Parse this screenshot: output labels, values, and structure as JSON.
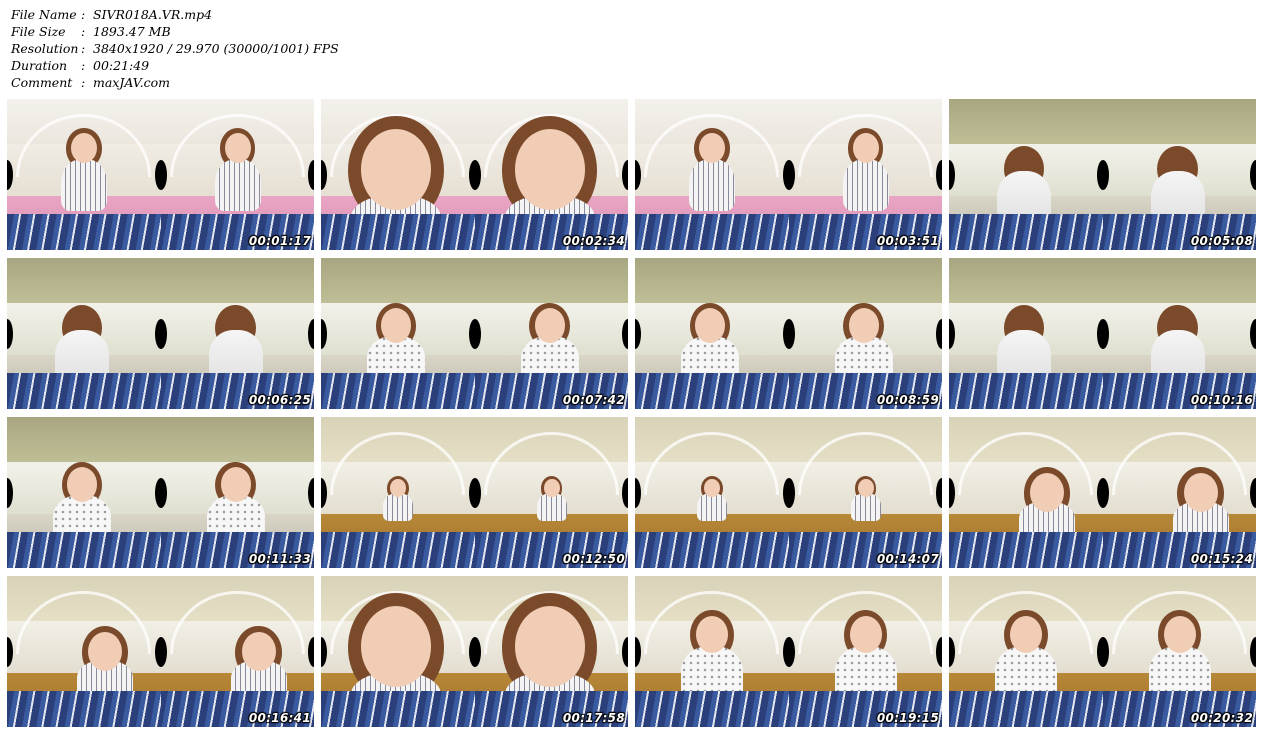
{
  "header": {
    "rows": [
      {
        "key": "File Name",
        "sep": ":",
        "value": "SIVR018A.VR.mp4"
      },
      {
        "key": "File Size",
        "sep": ":",
        "value": "1893.47 MB"
      },
      {
        "key": "Resolution",
        "sep": ":",
        "value": "3840x1920 / 29.970 (30000/1001) FPS"
      },
      {
        "key": "Duration",
        "sep": ":",
        "value": "00:21:49"
      },
      {
        "key": "Comment",
        "sep": ":",
        "value": "maxJAV.com"
      }
    ]
  },
  "thumbnails": [
    {
      "time": "00:01:17",
      "scene": "bedroom"
    },
    {
      "time": "00:02:34",
      "scene": "bedroom-closeup"
    },
    {
      "time": "00:03:51",
      "scene": "bedroom"
    },
    {
      "time": "00:05:08",
      "scene": "kitchen-back"
    },
    {
      "time": "00:06:25",
      "scene": "kitchen-back"
    },
    {
      "time": "00:07:42",
      "scene": "kitchen-front"
    },
    {
      "time": "00:08:59",
      "scene": "kitchen-front"
    },
    {
      "time": "00:10:16",
      "scene": "kitchen-back"
    },
    {
      "time": "00:11:33",
      "scene": "kitchen-front"
    },
    {
      "time": "00:12:50",
      "scene": "dining"
    },
    {
      "time": "00:14:07",
      "scene": "dining"
    },
    {
      "time": "00:15:24",
      "scene": "dining-near"
    },
    {
      "time": "00:16:41",
      "scene": "dining-lean"
    },
    {
      "time": "00:17:58",
      "scene": "dining-closeup"
    },
    {
      "time": "00:19:15",
      "scene": "dining-front"
    },
    {
      "time": "00:20:32",
      "scene": "dining-front"
    }
  ],
  "colors": {
    "timestamp": "#ffffff",
    "timestamp_outline": "#000000",
    "bedroom_wall": "#efeae2",
    "bedroom_bed": "#e9a6c4",
    "kitchen_wall": "#c8c8a0",
    "kitchen_cabinet": "#f2f2ea",
    "dining_floor": "#b88838",
    "blanket": "#2b3f7a"
  }
}
